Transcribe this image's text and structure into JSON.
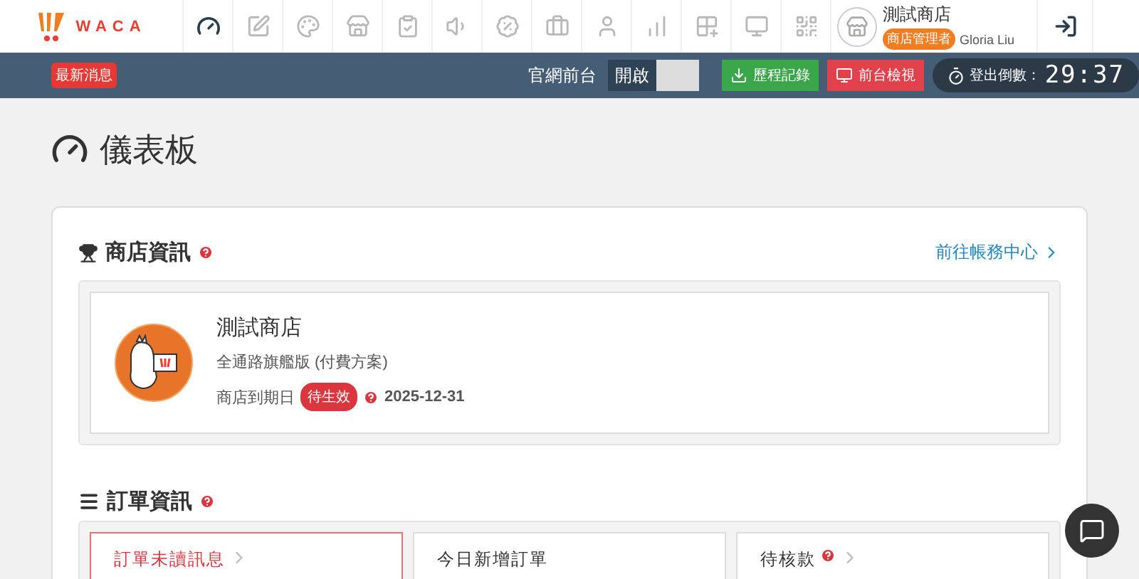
{
  "brand": {
    "name": "WACA"
  },
  "nav": [
    {
      "selected": true
    },
    {
      "selected": false
    },
    {
      "selected": false
    },
    {
      "selected": false
    },
    {
      "selected": false
    },
    {
      "selected": false
    },
    {
      "selected": false
    },
    {
      "selected": false
    },
    {
      "selected": false
    },
    {
      "selected": false
    },
    {
      "selected": false
    },
    {
      "selected": false
    },
    {
      "selected": false
    }
  ],
  "account": {
    "store": "測試商店",
    "role": "商店管理者",
    "user": "Gloria Liu"
  },
  "subbar": {
    "news": "最新消息",
    "site_label": "官網前台",
    "toggle_label": "開啟",
    "toggle_on": false,
    "buttons": [
      {
        "kind": "history",
        "label": "歷程記錄"
      },
      {
        "kind": "preview",
        "label": "前台檢視"
      }
    ],
    "logout_label": "登出倒數：",
    "countdown": "29:37"
  },
  "page_title": "儀表板",
  "store_info": {
    "title": "商店資訊",
    "link": "前往帳務中心",
    "name": "測試商店",
    "plan": "全通路旗艦版 (付費方案)",
    "expiry_label": "商店到期日",
    "status": "待生效",
    "expiry": "2025-12-31"
  },
  "orders": {
    "title": "訂單資訊",
    "cards": [
      {
        "label": "訂單未讀訊息",
        "alert": true,
        "help": false,
        "link": true
      },
      {
        "label": "今日新增訂單",
        "alert": false,
        "help": false,
        "link": false
      },
      {
        "label": "待核款",
        "alert": false,
        "help": true,
        "link": true
      }
    ]
  }
}
